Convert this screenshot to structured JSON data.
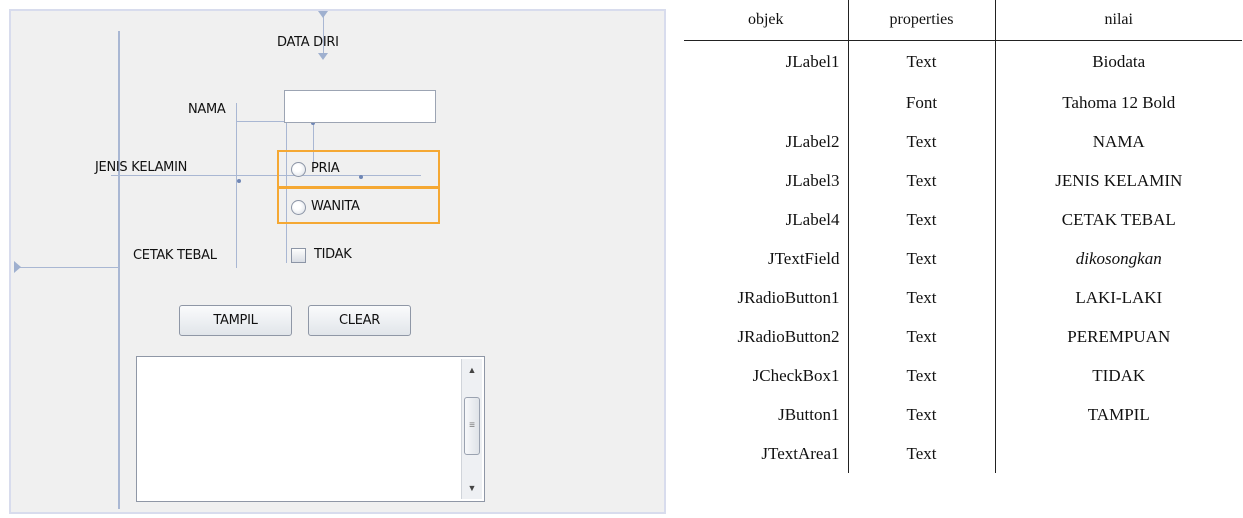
{
  "form": {
    "title_label": "DATA DIRI",
    "nama_label": "NAMA",
    "jenis_kelamin_label": "JENIS KELAMIN",
    "cetak_tebal_label": "CETAK TEBAL",
    "nama_value": "",
    "radio_1_label": "PRIA",
    "radio_2_label": "WANITA",
    "checkbox_label": "TIDAK",
    "button_1_label": "TAMPIL",
    "button_2_label": "CLEAR",
    "textarea_value": "",
    "scroll_up_icon": "up-arrow-icon",
    "scroll_down_icon": "down-arrow-icon",
    "scroll_grip": "≡",
    "selection_color": "#f5a833"
  },
  "table": {
    "headers": [
      "objek",
      "properties",
      "nilai"
    ],
    "rows": [
      {
        "objek": "JLabel1",
        "properties": "Text",
        "nilai": "Biodata"
      },
      {
        "objek": "",
        "properties": "Font",
        "nilai": "Tahoma 12 Bold"
      },
      {
        "objek": "JLabel2",
        "properties": "Text",
        "nilai": "NAMA"
      },
      {
        "objek": "JLabel3",
        "properties": "Text",
        "nilai": "JENIS KELAMIN"
      },
      {
        "objek": "JLabel4",
        "properties": "Text",
        "nilai": "CETAK TEBAL"
      },
      {
        "objek": "JTextField",
        "properties": "Text",
        "nilai": "dikosongkan"
      },
      {
        "objek": "JRadioButton1",
        "properties": "Text",
        "nilai": "LAKI-LAKI"
      },
      {
        "objek": "JRadioButton2",
        "properties": "Text",
        "nilai": "PEREMPUAN"
      },
      {
        "objek": "JCheckBox1",
        "properties": "Text",
        "nilai": "TIDAK"
      },
      {
        "objek": "JButton1",
        "properties": "Text",
        "nilai": "TAMPIL"
      },
      {
        "objek": "JTextArea1",
        "properties": "Text",
        "nilai": ""
      }
    ]
  }
}
